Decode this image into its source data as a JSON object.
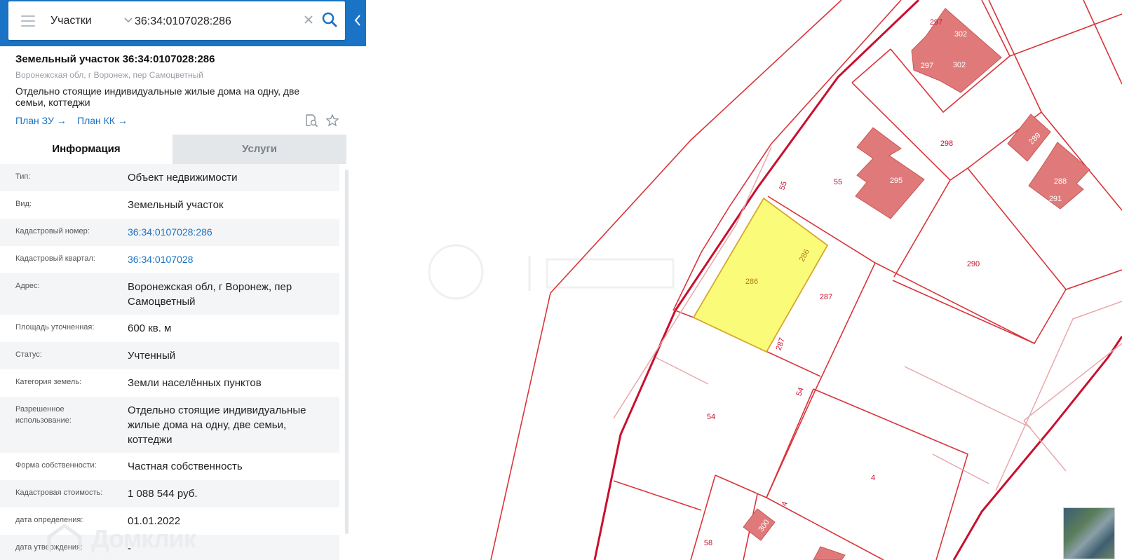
{
  "search": {
    "layer_label": "Участки",
    "query": "36:34:0107028:286"
  },
  "parcel": {
    "title": "Земельный участок 36:34:0107028:286",
    "address": "Воронежская обл, г Воронеж, пер Самоцветный",
    "purpose": "Отдельно стоящие индивидуальные жилые дома на одну, две семьи, коттеджи",
    "plan_zu": "План ЗУ →",
    "plan_kk": "План КК →"
  },
  "tabs": {
    "info": "Информация",
    "services": "Услуги"
  },
  "info_rows": [
    {
      "label": "Тип:",
      "value": "Объект недвижимости"
    },
    {
      "label": "Вид:",
      "value": "Земельный участок"
    },
    {
      "label": "Кадастровый номер:",
      "value": "36:34:0107028:286"
    },
    {
      "label": "Кадастровый квартал:",
      "value": "36:34:0107028"
    },
    {
      "label": "Адрес:",
      "value": "Воронежская обл, г Воронеж, пер Самоцветный"
    },
    {
      "label": "Площадь уточненная:",
      "value": "600 кв. м"
    },
    {
      "label": "Статус:",
      "value": "Учтенный"
    },
    {
      "label": "Категория земель:",
      "value": "Земли населённых пунктов"
    },
    {
      "label": "Разрешенное использование:",
      "value": "Отдельно стоящие индивидуальные жилые дома на одну, две семьи, коттеджи"
    },
    {
      "label": "Форма собственности:",
      "value": "Частная собственность"
    },
    {
      "label": "Кадастровая стоимость:",
      "value": "1 088 544 руб."
    },
    {
      "label": "дата определения:",
      "value": "01.01.2022"
    },
    {
      "label": "дата утверждения:",
      "value": "-"
    }
  ],
  "watermark": "Домклик",
  "map_labels": {
    "selected": "286",
    "p286_side": "286",
    "p287": "287",
    "p287_side": "287",
    "p55_side": "55",
    "p55": "55",
    "p295": "295",
    "p298": "298",
    "p297a": "297",
    "p297b": "297",
    "p302a": "302",
    "p302b": "302",
    "p289": "289",
    "p288": "288",
    "p291": "291",
    "p290": "290",
    "p54": "54",
    "p54_side": "54",
    "p4": "4",
    "p4_side": "4",
    "p300": "300",
    "p58": "58"
  },
  "colors": {
    "header_blue": "#1a73c5",
    "parcel_line": "#d9343a",
    "selected_fill": "#fbfb7a",
    "building_fill": "#e07a7a"
  }
}
